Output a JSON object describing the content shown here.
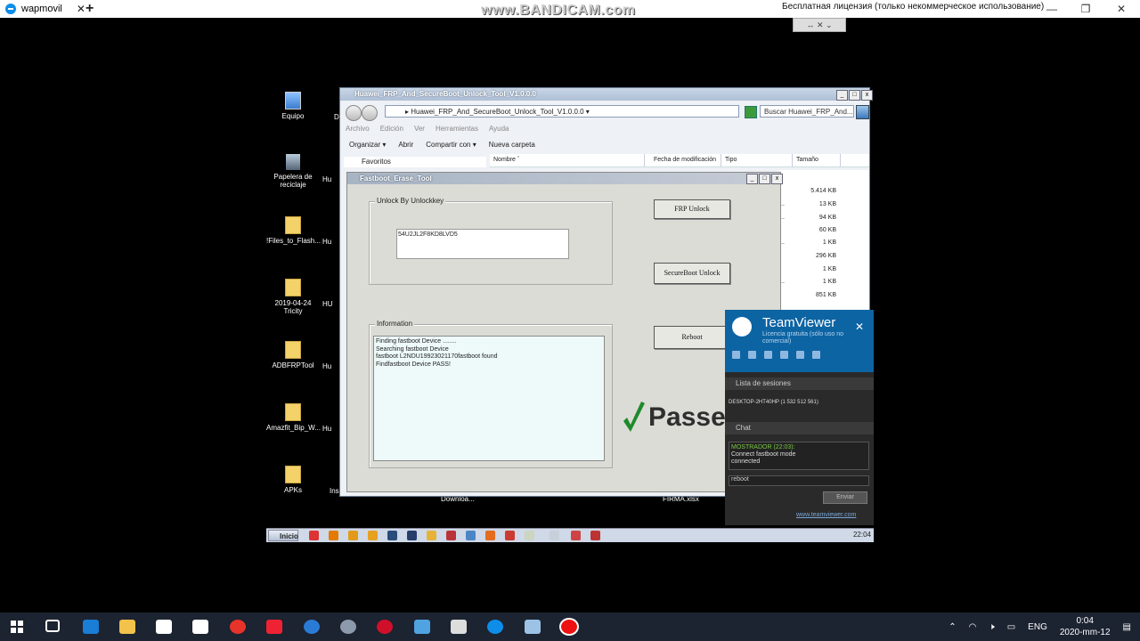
{
  "host": {
    "tab_title": "wapmovil",
    "close_glyph": "✕",
    "new_tab_glyph": "+",
    "watermark": "www.BANDICAM.com",
    "license_text": "Бесплатная лицензия (только некоммерческое использование)",
    "minimize_glyph": "—",
    "maximize_glyph": "❐",
    "window_close_glyph": "✕",
    "mini_toolbar_glyphs": "↔ ✕ ⌄"
  },
  "desktop_icons": [
    {
      "label": "Equipo",
      "icon": "computer-icon"
    },
    {
      "label": "Papelera de reciclaje",
      "icon": "recycle-bin-icon"
    },
    {
      "label": "!Files_to_Flash...",
      "icon": "folder-icon"
    },
    {
      "label": "2019-04-24 Tricity",
      "icon": "folder-icon"
    },
    {
      "label": "ADBFRPTool",
      "icon": "folder-icon"
    },
    {
      "label": "Amazfit_Bip_W...",
      "icon": "folder-icon"
    },
    {
      "label": "APKs",
      "icon": "folder-icon"
    }
  ],
  "desktop_clipped": {
    "d1": "Di",
    "hu": "Hu",
    "hu2": "HU",
    "ins": "Ins",
    "downloads": "Downloa...",
    "firma": "FIRMA.xlsx"
  },
  "explorer": {
    "title": "Huawei_FRP_And_SecureBoot_Unlock_Tool_V1.0.0.0",
    "address": "▸ Huawei_FRP_And_SecureBoot_Unlock_Tool_V1.0.0.0 ▾",
    "search_placeholder": "Buscar Huawei_FRP_And...",
    "menu": [
      "Archivo",
      "Edición",
      "Ver",
      "Herramientas",
      "Ayuda"
    ],
    "toolbar": {
      "organize": "Organizar ▾",
      "open": "Abrir",
      "share": "Compartir con ▾",
      "new_folder": "Nueva carpeta"
    },
    "favorites": "Favoritos",
    "columns": {
      "name": "Nombre ˆ",
      "date": "Fecha de modificación",
      "type": "Tipo",
      "size": "Tamaño"
    },
    "sizes": [
      "5.414 KB",
      "13 KB",
      "94 KB",
      "60 KB",
      "1 KB",
      "296 KB",
      "1 KB",
      "1 KB",
      "851 KB"
    ]
  },
  "fastboot_tool": {
    "title": "Fastboot_Erase_Tool",
    "unlock_group_label": "Unlock By Unlockkey",
    "unlock_key": "54U2JL2F8KD8LVD5",
    "frp_button": "FRP Unlock",
    "secureboot_button": "SecureBoot Unlock",
    "reboot_button": "Reboot",
    "info_group_label": "Information",
    "info_lines": [
      "Finding fastboot Device ........",
      "Searching fastboot Device",
      "fastboot L2NDU19923021170fastboot found",
      "Findfastboot Device PASS!"
    ],
    "passed_text": "Passe"
  },
  "teamviewer": {
    "name": "TeamViewer",
    "license": "Licencia gratuita (sólo uso no comercial)",
    "sessions_label": "Lista de sesiones",
    "session_item": "DESKTOP-2HT40HP (1 532 512 561)",
    "chat_label": "Chat",
    "chat_sender": "MOSTRADOR (22:03):",
    "chat_message_1": "Connect fastboot mode",
    "chat_message_2": "connected",
    "chat_input": "reboot",
    "send_button": "Enviar",
    "link": "www.teamviewer.com",
    "close_glyph": "✕"
  },
  "remote_taskbar": {
    "start": "Inicio",
    "clock": "22:04"
  },
  "host_taskbar": {
    "language": "ENG",
    "time": "0:04",
    "date": "2020-mm-12"
  }
}
